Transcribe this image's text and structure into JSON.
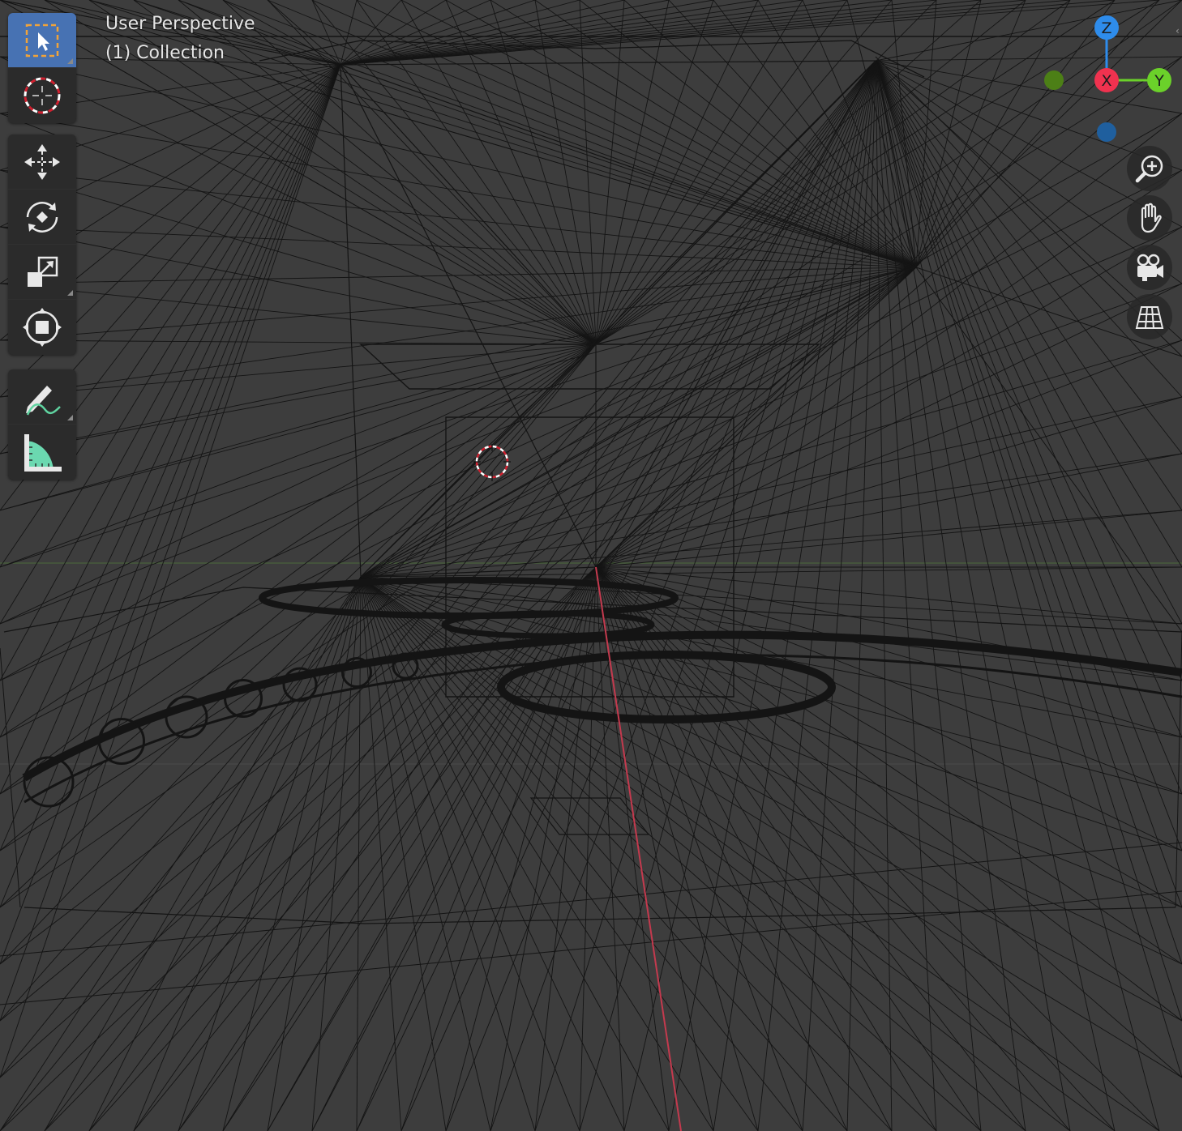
{
  "viewport": {
    "view_name": "User Perspective",
    "collection_name": "(1) Collection",
    "background_color": "#3d3d3d",
    "wire_color": "#141414",
    "x_axis_line_color": "#c43a4e",
    "y_axis_line_color": "#4a6a3a"
  },
  "toolbar": {
    "tools": [
      {
        "name": "select-box-tool",
        "icon": "select-box-icon",
        "active": true
      },
      {
        "name": "cursor-tool",
        "icon": "cursor-icon",
        "active": false
      },
      {
        "name": "move-tool",
        "icon": "move-icon",
        "active": false
      },
      {
        "name": "rotate-tool",
        "icon": "rotate-icon",
        "active": false
      },
      {
        "name": "scale-tool",
        "icon": "scale-icon",
        "active": false
      },
      {
        "name": "transform-tool",
        "icon": "transform-icon",
        "active": false
      },
      {
        "name": "annotate-tool",
        "icon": "annotate-icon",
        "active": false
      },
      {
        "name": "measure-tool",
        "icon": "measure-icon",
        "active": false
      }
    ],
    "active_color": "#4772b3"
  },
  "gizmo": {
    "z_label": "Z",
    "x_label": "X",
    "y_label": "Y",
    "z_color": "#2e8ceb",
    "x_color": "#f0324f",
    "y_color": "#6bd12a",
    "neg_y_color": "#4c7f16",
    "neg_z_color": "#1f5f9e"
  },
  "nav_buttons": [
    {
      "name": "zoom-button",
      "icon": "zoom-icon"
    },
    {
      "name": "pan-button",
      "icon": "hand-icon"
    },
    {
      "name": "camera-view-button",
      "icon": "camera-icon"
    },
    {
      "name": "ortho-toggle-button",
      "icon": "grid-icon"
    }
  ]
}
